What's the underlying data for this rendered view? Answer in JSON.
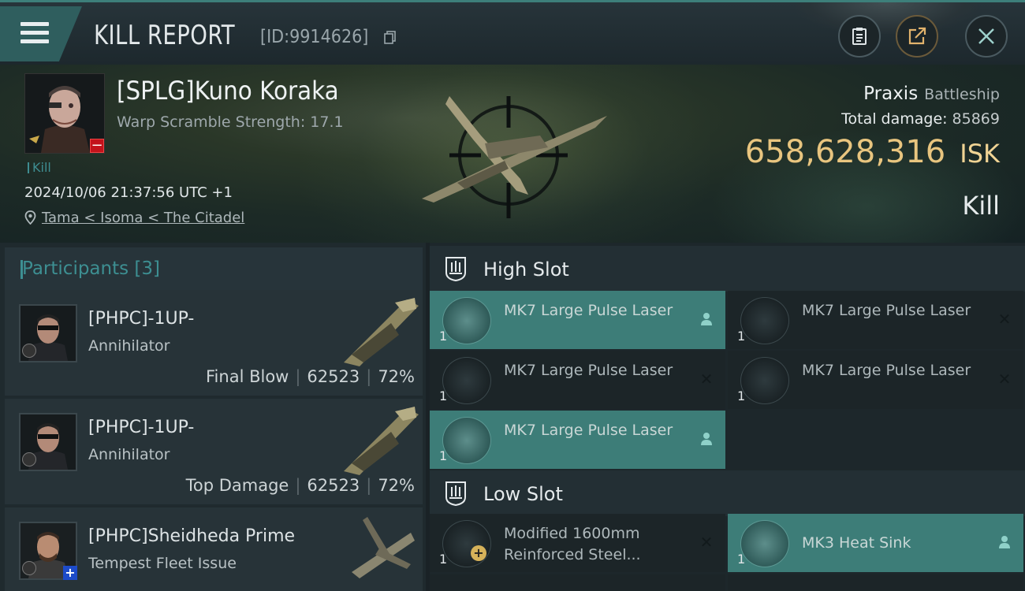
{
  "header": {
    "title": "KILL REPORT",
    "report_id": "[ID:9914626]",
    "icons": [
      "menu-icon",
      "copy-icon",
      "clipboard-icon",
      "share-icon",
      "close-icon"
    ]
  },
  "victim": {
    "name": "[SPLG]Kuno Koraka",
    "warp_scramble": "Warp Scramble Strength: 17.1",
    "kill_tag": "Kill",
    "datetime": "2024/10/06 21:37:56 UTC +1",
    "location": "Tama < Isoma < The Citadel",
    "ship_name": "Praxis",
    "ship_class": "Battleship",
    "total_damage_label": "Total damage:",
    "total_damage": "85869",
    "isk_value": "658,628,316",
    "isk_unit": "ISK",
    "result": "Kill"
  },
  "participants": {
    "label": "Participants",
    "count": "[3]",
    "rows": [
      {
        "name": "[PHPC]-1UP-",
        "ship": "Annihilator",
        "role": "Final Blow",
        "damage": "62523",
        "percent": "72%"
      },
      {
        "name": "[PHPC]-1UP-",
        "ship": "Annihilator",
        "role": "Top Damage",
        "damage": "62523",
        "percent": "72%"
      },
      {
        "name": "[PHPC]Sheidheda Prime",
        "ship": "Tempest Fleet Issue",
        "role": "",
        "damage": "",
        "percent": ""
      }
    ]
  },
  "slots": {
    "high": {
      "label": "High Slot",
      "modules": [
        {
          "name": "MK7 Large Pulse Laser",
          "qty": "1",
          "state": "person"
        },
        {
          "name": "MK7 Large Pulse Laser",
          "qty": "1",
          "state": "destroyed"
        },
        {
          "name": "MK7 Large Pulse Laser",
          "qty": "1",
          "state": "destroyed"
        },
        {
          "name": "MK7 Large Pulse Laser",
          "qty": "1",
          "state": "destroyed"
        },
        {
          "name": "MK7 Large Pulse Laser",
          "qty": "1",
          "state": "person"
        }
      ]
    },
    "low": {
      "label": "Low Slot",
      "modules": [
        {
          "name": "Modified 1600mm Reinforced Steel...",
          "qty": "1",
          "state": "destroyed"
        },
        {
          "name": "MK3 Heat Sink",
          "qty": "1",
          "state": "person"
        }
      ]
    }
  },
  "colors": {
    "accent": "#3d7d78",
    "isk": "#e9c57f",
    "danger": "#c3121b",
    "teal_text": "#3d8f92"
  }
}
